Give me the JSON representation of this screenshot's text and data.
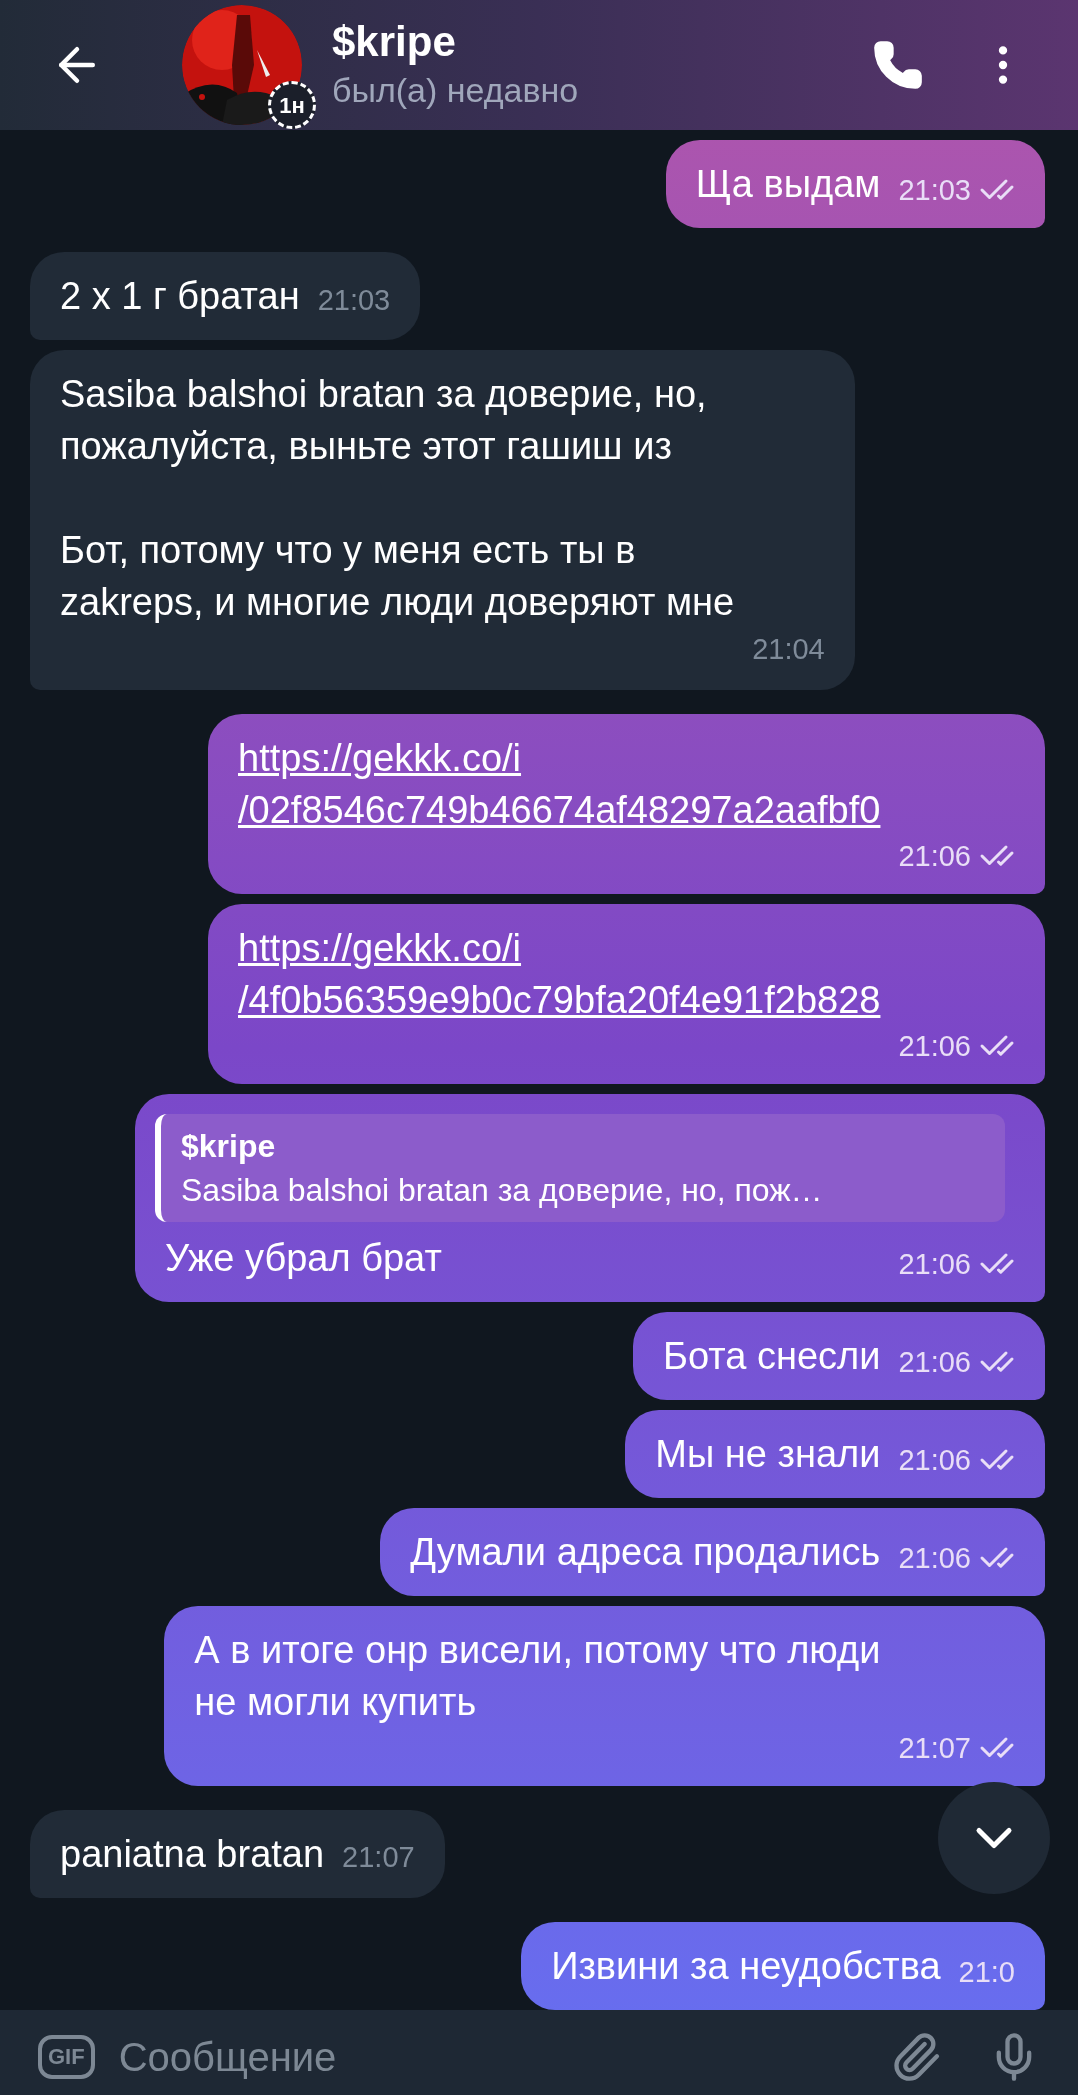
{
  "header": {
    "title": "$kripe",
    "status": "был(а) недавно",
    "story_badge": "1н"
  },
  "messages": [
    {
      "outgoing": true,
      "link": false,
      "text": "Ща выдам",
      "time": "21:03",
      "read": true
    },
    {
      "outgoing": false,
      "link": false,
      "text": "2 x 1 г братан",
      "time": "21:03"
    },
    {
      "outgoing": false,
      "link": false,
      "text": "Sasiba balshoi bratan за доверие, но,\nпожалуйста, выньте этот гашиш из\n\nБот, потому что у меня есть ты в\nzakreps, и многие люди доверяют мне",
      "time": "21:04"
    },
    {
      "outgoing": true,
      "link": true,
      "text": "https://gekkk.co/i\n/02f8546c749b46674af48297a2aafbf0",
      "time": "21:06",
      "read": true
    },
    {
      "outgoing": true,
      "link": true,
      "text": "https://gekkk.co/i\n/4f0b56359e9b0c79bfa20f4e91f2b828",
      "time": "21:06",
      "read": true
    },
    {
      "outgoing": true,
      "link": false,
      "reply": {
        "name": "$kripe",
        "text": "Sasiba balshoi bratan за доверие, но, пож…"
      },
      "text": "Уже убрал брат",
      "time": "21:06",
      "read": true
    },
    {
      "outgoing": true,
      "link": false,
      "text": "Бота снесли",
      "time": "21:06",
      "read": true
    },
    {
      "outgoing": true,
      "link": false,
      "text": "Мы не знали",
      "time": "21:06",
      "read": true
    },
    {
      "outgoing": true,
      "link": false,
      "text": "Думали адреса продались",
      "time": "21:06",
      "read": true
    },
    {
      "outgoing": true,
      "link": false,
      "text": "А в итоге онр висели, потому что люди\nне могли купить",
      "time": "21:07",
      "read": true
    },
    {
      "outgoing": false,
      "link": false,
      "text": "paniatna bratan",
      "time": "21:07"
    },
    {
      "outgoing": true,
      "link": false,
      "text": "Извини за неудобства",
      "time": "21:0"
    }
  ],
  "composer": {
    "gif_label": "GIF",
    "placeholder": "Сообщение"
  }
}
